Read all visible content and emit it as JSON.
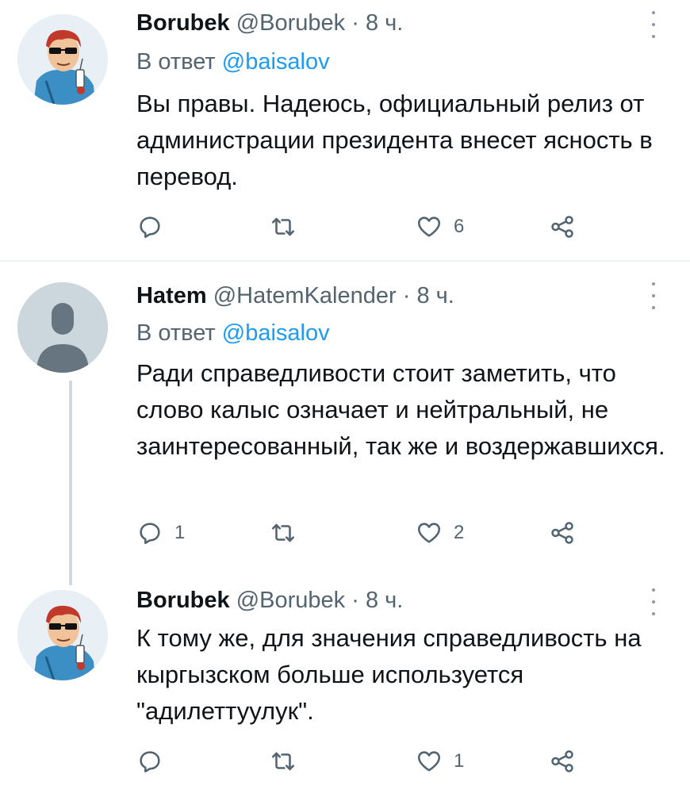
{
  "tweets": [
    {
      "name": "Borubek",
      "handle": "@Borubek",
      "separator": "·",
      "time": "8 ч.",
      "reply_prefix": "В ответ",
      "reply_to": "@baisalov",
      "text": "Вы правы. Надеюсь, официальный релиз от администрации президента внесет ясность в перевод.",
      "reply_count": "",
      "retweet_count": "",
      "like_count": "6"
    },
    {
      "name": "Hatem",
      "handle": "@HatemKalender",
      "separator": "·",
      "time": "8 ч.",
      "reply_prefix": "В ответ",
      "reply_to": "@baisalov",
      "text": "Ради справедливости стоит заметить, что слово калыс означает и нейтральный, не заинтересованный, так же и воздержавшихся.",
      "reply_count": "1",
      "retweet_count": "",
      "like_count": "2"
    },
    {
      "name": "Borubek",
      "handle": "@Borubek",
      "separator": "·",
      "time": "8 ч.",
      "text": "К тому же, для значения справедливость на кыргызском больше используется \"адилеттуулук\".",
      "reply_count": "",
      "retweet_count": "",
      "like_count": "1"
    }
  ],
  "icons": {
    "reply": "reply-icon",
    "retweet": "retweet-icon",
    "like": "heart-icon",
    "share": "share-icon",
    "menu": "more-vertical-icon"
  },
  "colors": {
    "link": "#1d9bf0",
    "secondary": "#536471",
    "text": "#0f1419"
  }
}
